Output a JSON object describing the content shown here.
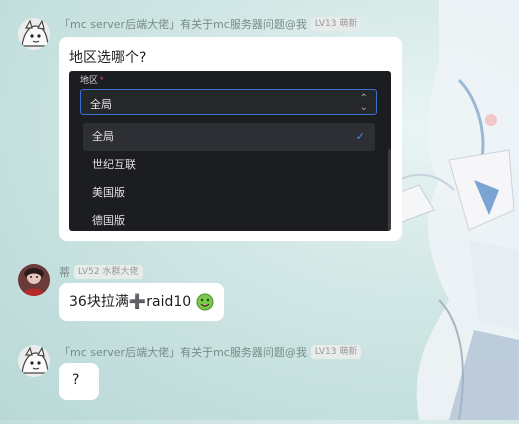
{
  "messages": [
    {
      "sender": "「mc server后端大佬」有关于mc服务器问题@我",
      "level": "LV13 萌新",
      "text": "地区选哪个?",
      "attachment": {
        "field_label": "地区",
        "required_mark": "*",
        "selected_value": "全局",
        "options": [
          "全局",
          "世纪互联",
          "美国版",
          "德国版"
        ],
        "check_mark": "✓"
      }
    },
    {
      "sender": "蒂",
      "level": "LV52 水群大佬",
      "text_prefix": "36块拉满",
      "text_plus": "➕",
      "text_suffix": "raid10"
    },
    {
      "sender": "「mc server后端大佬」有关于mc服务器问题@我",
      "level": "LV13 萌新",
      "text": "?"
    }
  ],
  "colors": {
    "background": "#cfe6e4",
    "bubble": "#ffffff",
    "panel": "#1c1d20",
    "accent": "#3b6fd0",
    "check": "#4a8df0"
  },
  "icons": [
    "avatar-cartoon-icon",
    "avatar-photo-icon",
    "chevron-updown-icon",
    "check-icon",
    "green-face-emoji"
  ]
}
